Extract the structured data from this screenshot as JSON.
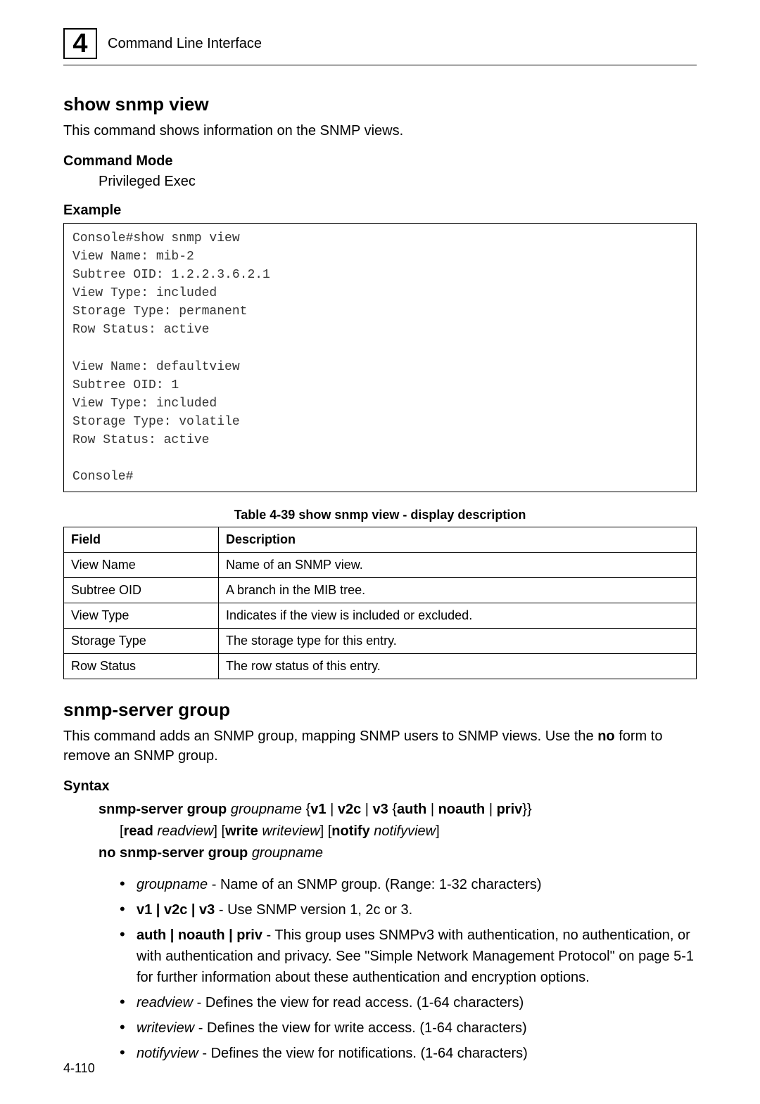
{
  "header": {
    "chapter_number": "4",
    "title": "Command Line Interface"
  },
  "section1": {
    "title": "show snmp view",
    "description": "This command shows information on the SNMP views.",
    "command_mode_heading": "Command Mode",
    "command_mode_value": "Privileged Exec",
    "example_heading": "Example",
    "example_code": "Console#show snmp view\nView Name: mib-2\nSubtree OID: 1.2.2.3.6.2.1\nView Type: included\nStorage Type: permanent\nRow Status: active\n\nView Name: defaultview\nSubtree OID: 1\nView Type: included\nStorage Type: volatile\nRow Status: active\n\nConsole#",
    "table_caption": "Table 4-39  show snmp view - display description",
    "table": {
      "headers": [
        "Field",
        "Description"
      ],
      "rows": [
        [
          "View Name",
          "Name of an SNMP view."
        ],
        [
          "Subtree OID",
          "A branch in the MIB tree."
        ],
        [
          "View Type",
          "Indicates if the view is included or excluded."
        ],
        [
          "Storage Type",
          "The storage type for this entry."
        ],
        [
          "Row Status",
          "The row status of this entry."
        ]
      ]
    }
  },
  "section2": {
    "title": "snmp-server group",
    "description_pre": "This command adds an SNMP group, mapping SNMP users to SNMP views. Use the ",
    "description_bold": "no",
    "description_post": " form to remove an SNMP group.",
    "syntax_heading": "Syntax",
    "syntax": {
      "line1_b1": "snmp-server group ",
      "line1_i1": "groupname",
      "line1_plain1": " {",
      "line1_b2": "v1 ",
      "line1_plain2": "| ",
      "line1_b3": "v2c ",
      "line1_plain3": "| ",
      "line1_b4": "v3 ",
      "line1_plain4": "{",
      "line1_b5": "auth ",
      "line1_plain5": "| ",
      "line1_b6": "noauth ",
      "line1_plain6": "| ",
      "line1_b7": "priv",
      "line1_plain7": "}}",
      "line2_plain1": "[",
      "line2_b1": "read ",
      "line2_i1": "readview",
      "line2_plain2": "] [",
      "line2_b2": "write ",
      "line2_i2": "writeview",
      "line2_plain3": "] [",
      "line2_b3": "notify ",
      "line2_i3": "notifyview",
      "line2_plain4": "]",
      "line3_b1": "no snmp-server group ",
      "line3_i1": "groupname"
    },
    "params": [
      {
        "pre_i": "groupname",
        "pre_plain": " - ",
        "text": "Name of an SNMP group. (Range: 1-32 characters)"
      },
      {
        "pre_b": "v1 | v2c | v3",
        "pre_plain": " - ",
        "text": "Use SNMP version 1, 2c or 3."
      },
      {
        "pre_b": "auth | noauth | priv",
        "pre_plain": " - ",
        "text": "This group uses SNMPv3 with authentication, no authentication, or with authentication and privacy. See \"Simple Network Management Protocol\" on page 5-1 for further information about these authentication and encryption options."
      },
      {
        "pre_i": "readview",
        "pre_plain": " - ",
        "text": "Defines the view for read access. (1-64 characters)"
      },
      {
        "pre_i": "writeview",
        "pre_plain": " - ",
        "text": "Defines the view for write access. (1-64 characters)"
      },
      {
        "pre_i": "notifyview",
        "pre_plain": " - ",
        "text": "Defines the view for notifications. (1-64 characters)"
      }
    ]
  },
  "page_number": "4-110"
}
